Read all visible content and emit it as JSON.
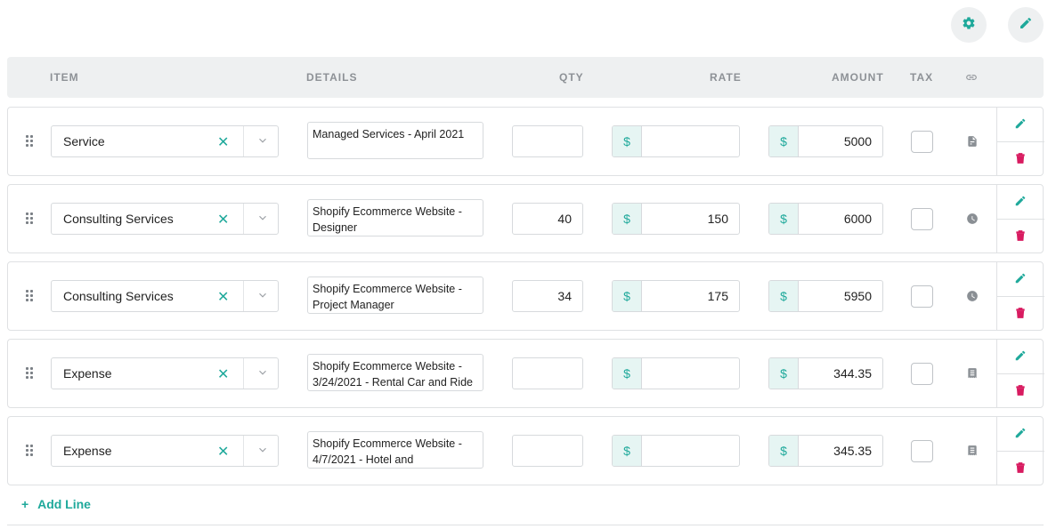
{
  "toolbar": {
    "settings_icon": "gear-icon",
    "edit_icon": "pencil-icon"
  },
  "columns": {
    "item": "ITEM",
    "details": "DETAILS",
    "qty": "QTY",
    "rate": "RATE",
    "amount": "AMOUNT",
    "tax": "TAX",
    "link_icon": "link-icon"
  },
  "currency_symbol": "$",
  "rows": [
    {
      "item": "Service",
      "details": "Managed Services - April 2021",
      "qty": "",
      "rate": "",
      "amount": "5000",
      "tax": false,
      "type_icon": "document-icon"
    },
    {
      "item": "Consulting Services",
      "details": "Shopify Ecommerce Website - Designer",
      "qty": "40",
      "rate": "150",
      "amount": "6000",
      "tax": false,
      "type_icon": "clock-icon"
    },
    {
      "item": "Consulting Services",
      "details": "Shopify Ecommerce Website - Project Manager",
      "qty": "34",
      "rate": "175",
      "amount": "5950",
      "tax": false,
      "type_icon": "clock-icon"
    },
    {
      "item": "Expense",
      "details": "Shopify Ecommerce Website - 3/24/2021 - Rental Car and Ride",
      "qty": "",
      "rate": "",
      "amount": "344.35",
      "tax": false,
      "type_icon": "receipt-icon"
    },
    {
      "item": "Expense",
      "details": "Shopify Ecommerce Website - 4/7/2021 - Hotel and",
      "qty": "",
      "rate": "",
      "amount": "345.35",
      "tax": false,
      "type_icon": "receipt-icon"
    }
  ],
  "add_line": {
    "plus": "+",
    "label": "Add Line"
  },
  "colors": {
    "accent": "#1fa99b",
    "delete": "#d81b60",
    "header_bg": "#eef0f1"
  }
}
